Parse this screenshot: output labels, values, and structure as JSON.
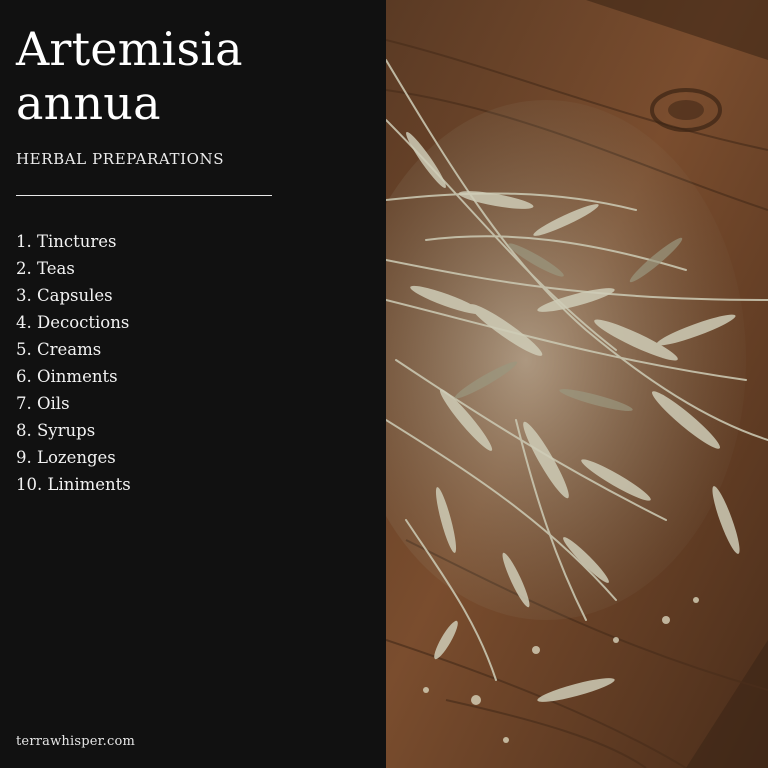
{
  "title_lines": [
    "Artemisia",
    "annua"
  ],
  "subtitle": "HERBAL PREPARATIONS",
  "preparations": [
    "1. Tinctures",
    "2. Teas",
    "3. Capsules",
    "4. Decoctions",
    "5. Creams",
    "6. Oinments",
    "7. Oils",
    "8. Syrups",
    "9. Lozenges",
    "10. Liniments"
  ],
  "footer": "terrawhisper.com",
  "colors": {
    "panel_background": "#111111",
    "text": "#ffffff",
    "wood": "#6b4327",
    "herb": "#b9b7a0"
  },
  "photo_subject": "dried-artemisia-herb-on-wooden-board"
}
